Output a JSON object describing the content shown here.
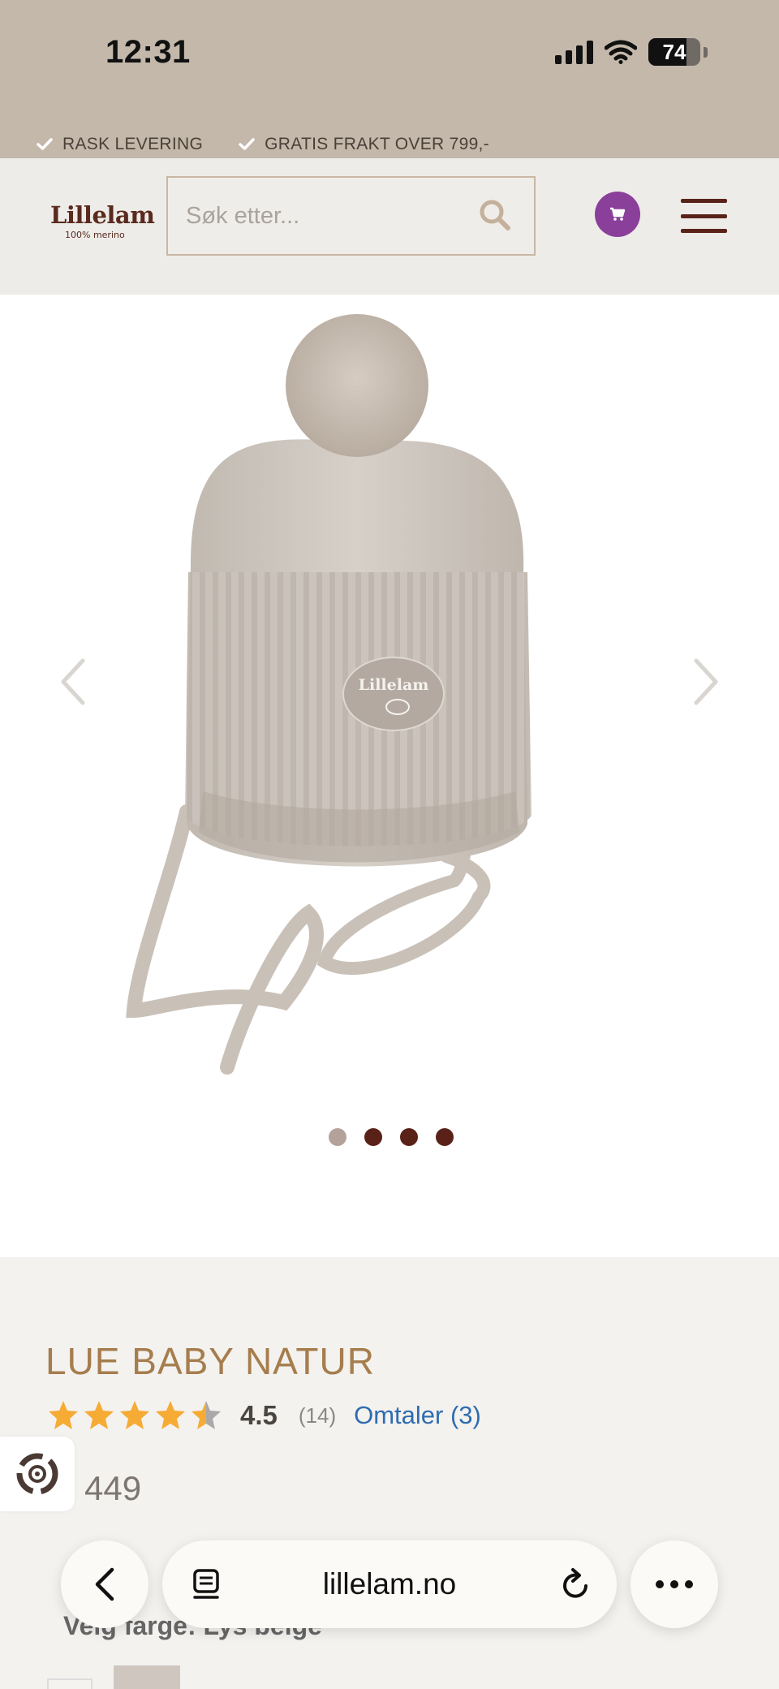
{
  "status_bar": {
    "time": "12:31",
    "battery": 74
  },
  "promo": {
    "items": [
      "RASK LEVERING",
      "GRATIS FRAKT OVER 799,-"
    ]
  },
  "header": {
    "logo_name": "Lillelam",
    "logo_tagline": "100% merino",
    "search_placeholder": "Søk etter...",
    "icons": [
      "search-icon",
      "cart-icon",
      "hamburger-menu-icon"
    ]
  },
  "gallery": {
    "slide_count": 4,
    "active_slide": 1,
    "icons": [
      "chevron-left-icon",
      "chevron-right-icon"
    ],
    "hat_label": "Lillelam"
  },
  "product": {
    "title": "LUE BABY NATUR",
    "rating": "4.5",
    "rating_stars": 4.5,
    "rating_count": "(14)",
    "reviews_link": "Omtaler (3)",
    "price": "449",
    "color_label": "Velg farge: Lys beige"
  },
  "browser": {
    "url": "lillelam.no",
    "icons": [
      "back-icon",
      "tabs-icon",
      "reload-icon",
      "more-icon"
    ]
  },
  "colors": {
    "topband": "#c3b8aa",
    "brand_brown": "#5a231a",
    "title_gold": "#a67d4d",
    "link_blue": "#2f6cb0",
    "cart_purple": "#8a3f9a",
    "star": "#f6ab35"
  }
}
